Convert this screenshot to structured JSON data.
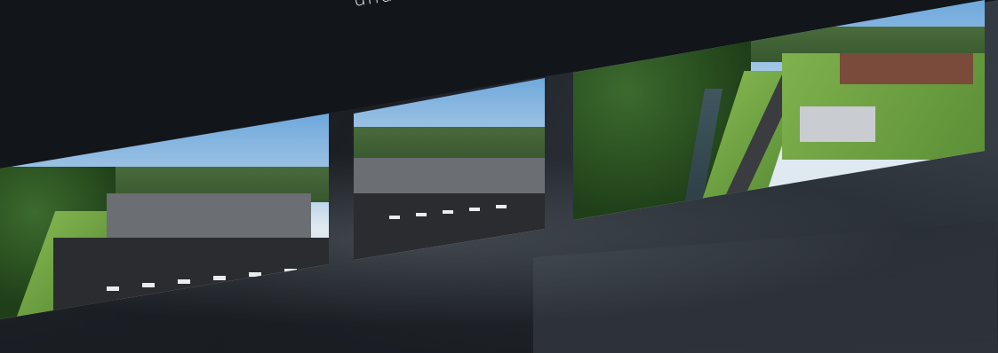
{
  "hero": {
    "tagline_partial": "und mi..."
  },
  "photos": [
    {
      "name": "aerial-factory-left",
      "icon": "aerial-photo"
    },
    {
      "name": "aerial-factory-center",
      "icon": "aerial-photo"
    },
    {
      "name": "aerial-river-industrial",
      "icon": "aerial-photo"
    }
  ],
  "colors": {
    "background": "#15181c",
    "tagline": "#e9ecef"
  }
}
